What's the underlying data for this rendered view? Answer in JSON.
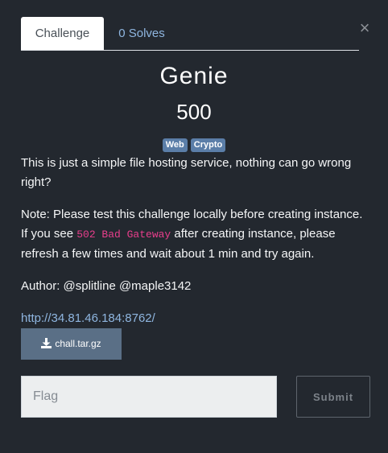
{
  "modal": {
    "close_glyph": "×"
  },
  "tabs": [
    {
      "label": "Challenge",
      "active": true
    },
    {
      "label": "0 Solves",
      "active": false
    }
  ],
  "challenge": {
    "name": "Genie",
    "points": "500",
    "tags": [
      "Web",
      "Crypto"
    ],
    "description_1": "This is just a simple file hosting service, nothing can go wrong right?",
    "note_prefix": "Note: Please test this challenge locally before creating instance. If you see ",
    "note_code": "502 Bad Gateway",
    "note_suffix": " after creating instance, please refresh a few times and wait about 1 min and try again.",
    "author": "Author: @splitline @maple3142",
    "url": "http://34.81.46.184:8762/",
    "file_name": "chall.tar.gz"
  },
  "form": {
    "flag_placeholder": "Flag",
    "flag_value": "",
    "submit_label": "Submit"
  },
  "colors": {
    "background": "#23282f",
    "link": "#8fb6e0",
    "tag": "#5b7ea8",
    "download_button": "#5a6f86",
    "code": "#e83e8c"
  },
  "icons": {
    "close": "close-icon",
    "download": "download-icon"
  }
}
